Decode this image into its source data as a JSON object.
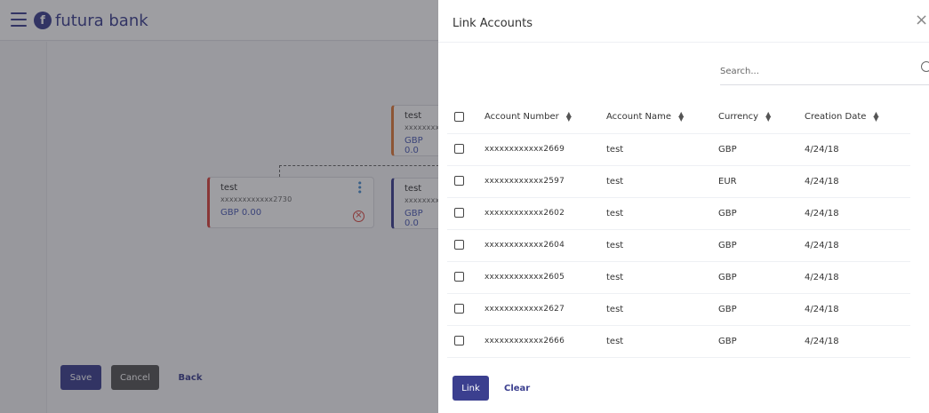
{
  "app": {
    "brand": "futura bank",
    "brand_mark": "f"
  },
  "background": {
    "nodes": [
      {
        "name": "test",
        "account": "xxxxxxxx",
        "balance": "GBP 0.0"
      },
      {
        "name": "test",
        "account": "xxxxxxxx",
        "balance": "GBP 0.0"
      },
      {
        "name": "test",
        "account": "xxxxxxxxxxxx2730",
        "balance": "GBP 0.00"
      }
    ],
    "buttons": {
      "save": "Save",
      "cancel": "Cancel",
      "back": "Back"
    }
  },
  "panel": {
    "title": "Link Accounts",
    "search": {
      "placeholder": "Search...",
      "value": ""
    },
    "columns": [
      "Account Number",
      "Account Name",
      "Currency",
      "Creation Date"
    ],
    "rows": [
      {
        "account_number": "xxxxxxxxxxxx2669",
        "account_name": "test",
        "currency": "GBP",
        "creation_date": "4/24/18"
      },
      {
        "account_number": "xxxxxxxxxxxx2597",
        "account_name": "test",
        "currency": "EUR",
        "creation_date": "4/24/18"
      },
      {
        "account_number": "xxxxxxxxxxxx2602",
        "account_name": "test",
        "currency": "GBP",
        "creation_date": "4/24/18"
      },
      {
        "account_number": "xxxxxxxxxxxx2604",
        "account_name": "test",
        "currency": "GBP",
        "creation_date": "4/24/18"
      },
      {
        "account_number": "xxxxxxxxxxxx2605",
        "account_name": "test",
        "currency": "GBP",
        "creation_date": "4/24/18"
      },
      {
        "account_number": "xxxxxxxxxxxx2627",
        "account_name": "test",
        "currency": "GBP",
        "creation_date": "4/24/18"
      },
      {
        "account_number": "xxxxxxxxxxxx2666",
        "account_name": "test",
        "currency": "GBP",
        "creation_date": "4/24/18"
      }
    ],
    "buttons": {
      "link": "Link",
      "clear": "Clear"
    }
  },
  "colors": {
    "brand": "#3b3f8f",
    "node_orange": "#e07a3a",
    "node_red": "#d9443d",
    "node_blue": "#3b3f8f"
  }
}
